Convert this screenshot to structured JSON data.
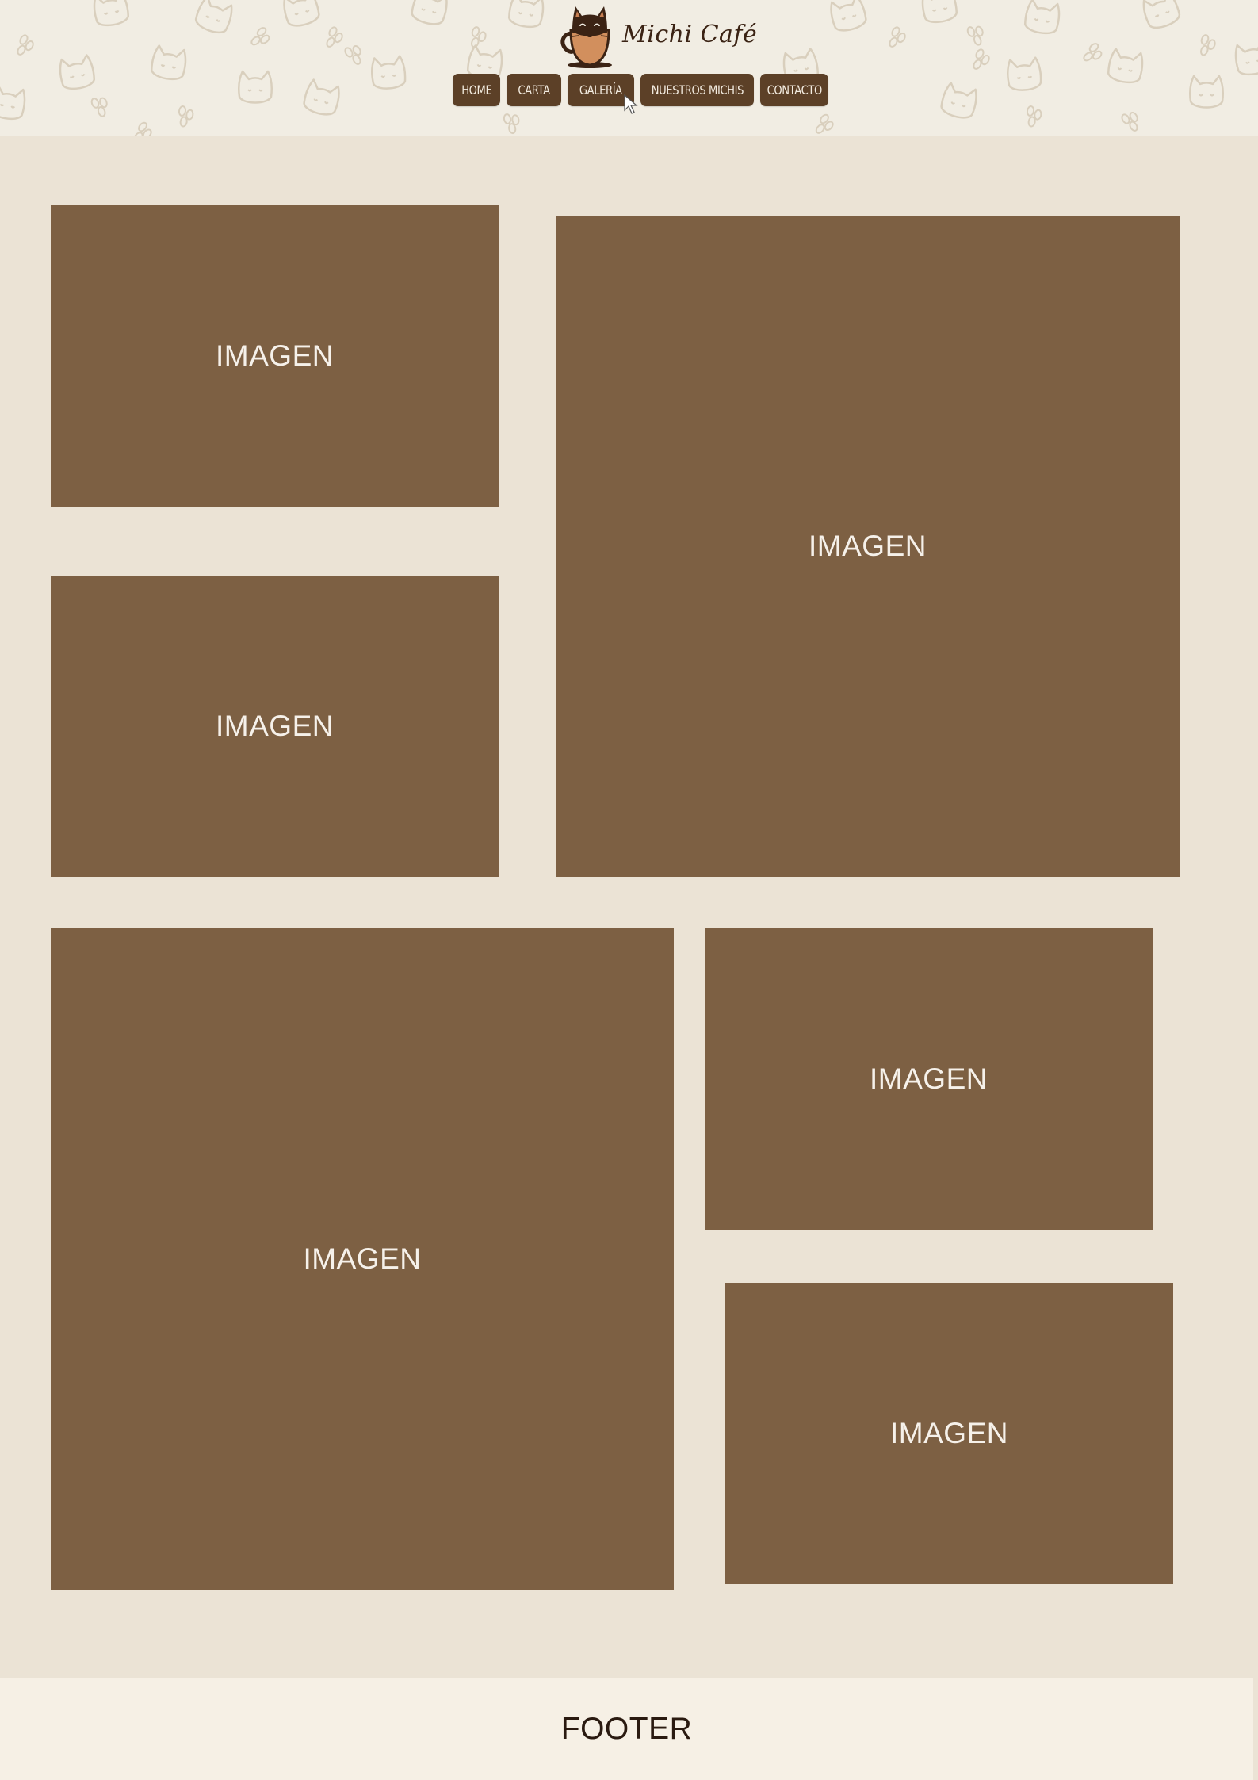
{
  "header": {
    "logo": {
      "icon": "cat-in-cup-icon",
      "text": "Michi Café"
    },
    "nav": [
      {
        "label": "HOME"
      },
      {
        "label": "CARTA"
      },
      {
        "label": "GALERÍA"
      },
      {
        "label": "NUESTROS MICHIS"
      },
      {
        "label": "CONTACTO"
      }
    ]
  },
  "gallery": {
    "tiles": [
      {
        "label": "IMAGEN"
      },
      {
        "label": "IMAGEN"
      },
      {
        "label": "IMAGEN"
      },
      {
        "label": "IMAGEN"
      },
      {
        "label": "IMAGEN"
      },
      {
        "label": "IMAGEN"
      }
    ]
  },
  "footer": {
    "text": "FOOTER"
  },
  "colors": {
    "page_bg": "#ebe3d5",
    "header_bg": "#f1ede3",
    "nav_button": "#5c4027",
    "tile": "#7d6043",
    "footer_bg": "#f6f0e5"
  }
}
